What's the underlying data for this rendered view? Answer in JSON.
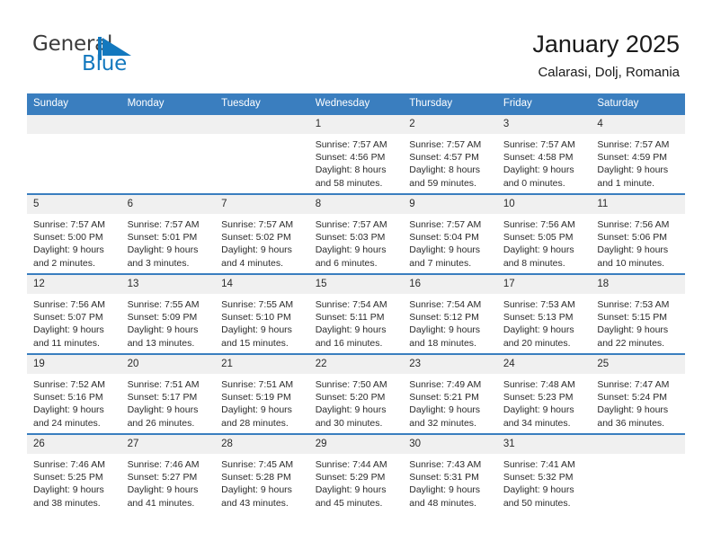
{
  "logo": {
    "word_one": "General",
    "word_two": "Blue",
    "flag_icon": "blue-flag-triangle",
    "brand_blue": "#1378be"
  },
  "header": {
    "title": "January 2025",
    "location": "Calarasi, Dolj, Romania"
  },
  "colors": {
    "header_blue": "#3a7ebf",
    "row_rule": "#2e6da4",
    "daynum_band": "#f0f0f0",
    "text": "#2b2b2b"
  },
  "calendar": {
    "weekday_headers": [
      "Sunday",
      "Monday",
      "Tuesday",
      "Wednesday",
      "Thursday",
      "Friday",
      "Saturday"
    ],
    "weeks": [
      [
        {
          "day": "",
          "blank": true
        },
        {
          "day": "",
          "blank": true
        },
        {
          "day": "",
          "blank": true
        },
        {
          "day": "1",
          "sunrise": "Sunrise: 7:57 AM",
          "sunset": "Sunset: 4:56 PM",
          "daylight": "Daylight: 8 hours and 58 minutes."
        },
        {
          "day": "2",
          "sunrise": "Sunrise: 7:57 AM",
          "sunset": "Sunset: 4:57 PM",
          "daylight": "Daylight: 8 hours and 59 minutes."
        },
        {
          "day": "3",
          "sunrise": "Sunrise: 7:57 AM",
          "sunset": "Sunset: 4:58 PM",
          "daylight": "Daylight: 9 hours and 0 minutes."
        },
        {
          "day": "4",
          "sunrise": "Sunrise: 7:57 AM",
          "sunset": "Sunset: 4:59 PM",
          "daylight": "Daylight: 9 hours and 1 minute."
        }
      ],
      [
        {
          "day": "5",
          "sunrise": "Sunrise: 7:57 AM",
          "sunset": "Sunset: 5:00 PM",
          "daylight": "Daylight: 9 hours and 2 minutes."
        },
        {
          "day": "6",
          "sunrise": "Sunrise: 7:57 AM",
          "sunset": "Sunset: 5:01 PM",
          "daylight": "Daylight: 9 hours and 3 minutes."
        },
        {
          "day": "7",
          "sunrise": "Sunrise: 7:57 AM",
          "sunset": "Sunset: 5:02 PM",
          "daylight": "Daylight: 9 hours and 4 minutes."
        },
        {
          "day": "8",
          "sunrise": "Sunrise: 7:57 AM",
          "sunset": "Sunset: 5:03 PM",
          "daylight": "Daylight: 9 hours and 6 minutes."
        },
        {
          "day": "9",
          "sunrise": "Sunrise: 7:57 AM",
          "sunset": "Sunset: 5:04 PM",
          "daylight": "Daylight: 9 hours and 7 minutes."
        },
        {
          "day": "10",
          "sunrise": "Sunrise: 7:56 AM",
          "sunset": "Sunset: 5:05 PM",
          "daylight": "Daylight: 9 hours and 8 minutes."
        },
        {
          "day": "11",
          "sunrise": "Sunrise: 7:56 AM",
          "sunset": "Sunset: 5:06 PM",
          "daylight": "Daylight: 9 hours and 10 minutes."
        }
      ],
      [
        {
          "day": "12",
          "sunrise": "Sunrise: 7:56 AM",
          "sunset": "Sunset: 5:07 PM",
          "daylight": "Daylight: 9 hours and 11 minutes."
        },
        {
          "day": "13",
          "sunrise": "Sunrise: 7:55 AM",
          "sunset": "Sunset: 5:09 PM",
          "daylight": "Daylight: 9 hours and 13 minutes."
        },
        {
          "day": "14",
          "sunrise": "Sunrise: 7:55 AM",
          "sunset": "Sunset: 5:10 PM",
          "daylight": "Daylight: 9 hours and 15 minutes."
        },
        {
          "day": "15",
          "sunrise": "Sunrise: 7:54 AM",
          "sunset": "Sunset: 5:11 PM",
          "daylight": "Daylight: 9 hours and 16 minutes."
        },
        {
          "day": "16",
          "sunrise": "Sunrise: 7:54 AM",
          "sunset": "Sunset: 5:12 PM",
          "daylight": "Daylight: 9 hours and 18 minutes."
        },
        {
          "day": "17",
          "sunrise": "Sunrise: 7:53 AM",
          "sunset": "Sunset: 5:13 PM",
          "daylight": "Daylight: 9 hours and 20 minutes."
        },
        {
          "day": "18",
          "sunrise": "Sunrise: 7:53 AM",
          "sunset": "Sunset: 5:15 PM",
          "daylight": "Daylight: 9 hours and 22 minutes."
        }
      ],
      [
        {
          "day": "19",
          "sunrise": "Sunrise: 7:52 AM",
          "sunset": "Sunset: 5:16 PM",
          "daylight": "Daylight: 9 hours and 24 minutes."
        },
        {
          "day": "20",
          "sunrise": "Sunrise: 7:51 AM",
          "sunset": "Sunset: 5:17 PM",
          "daylight": "Daylight: 9 hours and 26 minutes."
        },
        {
          "day": "21",
          "sunrise": "Sunrise: 7:51 AM",
          "sunset": "Sunset: 5:19 PM",
          "daylight": "Daylight: 9 hours and 28 minutes."
        },
        {
          "day": "22",
          "sunrise": "Sunrise: 7:50 AM",
          "sunset": "Sunset: 5:20 PM",
          "daylight": "Daylight: 9 hours and 30 minutes."
        },
        {
          "day": "23",
          "sunrise": "Sunrise: 7:49 AM",
          "sunset": "Sunset: 5:21 PM",
          "daylight": "Daylight: 9 hours and 32 minutes."
        },
        {
          "day": "24",
          "sunrise": "Sunrise: 7:48 AM",
          "sunset": "Sunset: 5:23 PM",
          "daylight": "Daylight: 9 hours and 34 minutes."
        },
        {
          "day": "25",
          "sunrise": "Sunrise: 7:47 AM",
          "sunset": "Sunset: 5:24 PM",
          "daylight": "Daylight: 9 hours and 36 minutes."
        }
      ],
      [
        {
          "day": "26",
          "sunrise": "Sunrise: 7:46 AM",
          "sunset": "Sunset: 5:25 PM",
          "daylight": "Daylight: 9 hours and 38 minutes."
        },
        {
          "day": "27",
          "sunrise": "Sunrise: 7:46 AM",
          "sunset": "Sunset: 5:27 PM",
          "daylight": "Daylight: 9 hours and 41 minutes."
        },
        {
          "day": "28",
          "sunrise": "Sunrise: 7:45 AM",
          "sunset": "Sunset: 5:28 PM",
          "daylight": "Daylight: 9 hours and 43 minutes."
        },
        {
          "day": "29",
          "sunrise": "Sunrise: 7:44 AM",
          "sunset": "Sunset: 5:29 PM",
          "daylight": "Daylight: 9 hours and 45 minutes."
        },
        {
          "day": "30",
          "sunrise": "Sunrise: 7:43 AM",
          "sunset": "Sunset: 5:31 PM",
          "daylight": "Daylight: 9 hours and 48 minutes."
        },
        {
          "day": "31",
          "sunrise": "Sunrise: 7:41 AM",
          "sunset": "Sunset: 5:32 PM",
          "daylight": "Daylight: 9 hours and 50 minutes."
        },
        {
          "day": "",
          "blank": true
        }
      ]
    ]
  }
}
